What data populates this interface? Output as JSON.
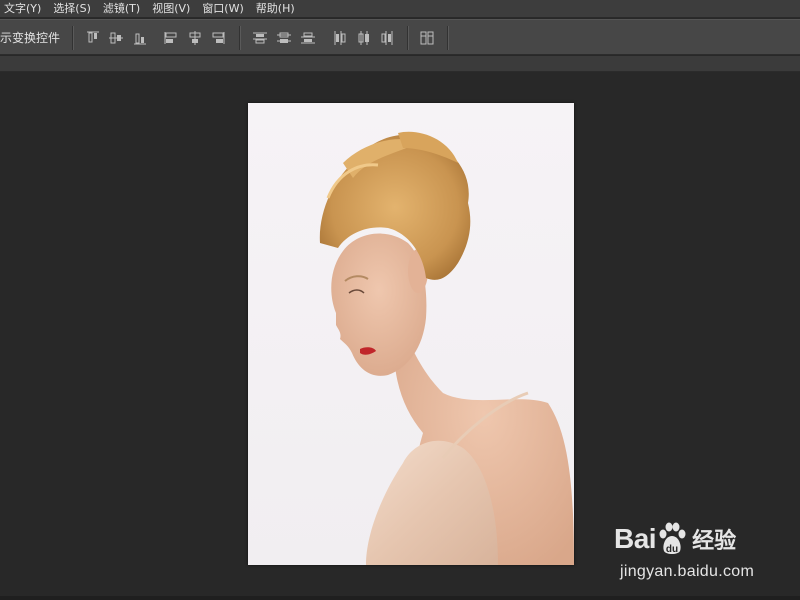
{
  "menubar": {
    "items": [
      {
        "label": "文字(Y)"
      },
      {
        "label": "选择(S)"
      },
      {
        "label": "滤镜(T)"
      },
      {
        "label": "视图(V)"
      },
      {
        "label": "窗口(W)"
      },
      {
        "label": "帮助(H)"
      }
    ]
  },
  "options_bar": {
    "transform_controls_label": "示变换控件",
    "align_buttons": [
      {
        "icon": "align-top-edges-icon"
      },
      {
        "icon": "align-vertical-centers-icon"
      },
      {
        "icon": "align-bottom-edges-icon"
      },
      {
        "icon": "align-left-edges-icon"
      },
      {
        "icon": "align-horizontal-centers-icon"
      },
      {
        "icon": "align-right-edges-icon"
      }
    ],
    "distribute_buttons": [
      {
        "icon": "distribute-top-edges-icon"
      },
      {
        "icon": "distribute-vertical-centers-icon"
      },
      {
        "icon": "distribute-bottom-edges-icon"
      },
      {
        "icon": "distribute-left-edges-icon"
      },
      {
        "icon": "distribute-horizontal-centers-icon"
      },
      {
        "icon": "distribute-right-edges-icon"
      }
    ],
    "auto_align_button": {
      "icon": "auto-align-layers-icon"
    }
  },
  "canvas": {
    "image": "profile-portrait-woman-updo"
  },
  "watermark": {
    "brand_left": "Bai",
    "brand_right": "du",
    "brand_cn": "经验",
    "url": "jingyan.baidu.com"
  },
  "colors": {
    "menubar_bg": "#3d3d3d",
    "options_bg": "#474747",
    "workspace_bg": "#282828",
    "text": "#e2e2e2"
  }
}
